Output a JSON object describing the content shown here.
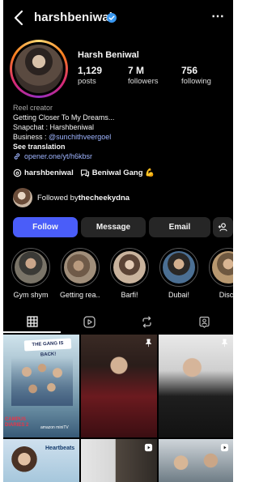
{
  "header": {
    "username": "harshbeniwal",
    "more_label": "⋯"
  },
  "profile": {
    "display_name": "Harsh Beniwal",
    "stats": [
      {
        "value": "1,129",
        "label": "posts"
      },
      {
        "value": "7 M",
        "label": "followers"
      },
      {
        "value": "756",
        "label": "following"
      }
    ]
  },
  "bio": {
    "category": "Reel creator",
    "lines": [
      "Getting Closer To My Dreams...",
      "Snapchat : Harshbeniwal"
    ],
    "business_prefix": "Business : ",
    "business_handle": "@sunchithveergoel",
    "see_translation": "See translation",
    "link": "opener.one/yt/h6kbsr"
  },
  "threads": {
    "handle": "harshbeniwal",
    "channel": "Beniwal Gang 💪"
  },
  "followed_by": {
    "prefix": "Followed by ",
    "name": "thecheekydna"
  },
  "actions": {
    "follow": "Follow",
    "message": "Message",
    "email": "Email"
  },
  "highlights": [
    {
      "label": "Gym shym"
    },
    {
      "label": "Getting rea..."
    },
    {
      "label": "Barfi!"
    },
    {
      "label": "Dubai!"
    },
    {
      "label": "Disco"
    }
  ],
  "tabs": [
    "posts-grid-icon",
    "reels-icon",
    "reposts-icon",
    "tagged-icon"
  ],
  "grid": {
    "post1_title": "THE GANG IS BACK!",
    "post1_subtitle": "CAMPUS DIARIES 2",
    "post1_platform": "amazon miniTV",
    "post4_title": "Heartbeats"
  },
  "colors": {
    "accent": "#4a5df9",
    "link": "#9fb5ff",
    "verified": "#3897f0"
  }
}
